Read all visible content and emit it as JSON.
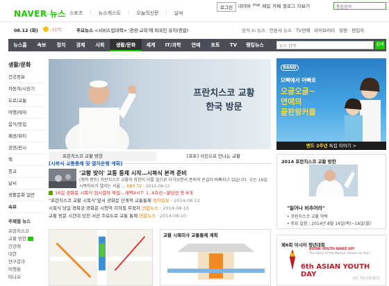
{
  "brand": {
    "logo": "NAVER",
    "section": "뉴스"
  },
  "top_nav": [
    "스포츠",
    "뉴스캐스트",
    "오늘의신문",
    "날씨"
  ],
  "util_links": {
    "login": "로그인",
    "items": [
      "네이버",
      "me",
      "메일",
      "카페",
      "블로그",
      "더보기"
    ]
  },
  "top_search": {
    "placeholder": "통합검색"
  },
  "datebar": {
    "date": "08.12 (화)",
    "temp": "31℃",
    "hot_label": "주요뉴스",
    "hot_text": "<서비스업대책> '관광·교육'에 외국인 유치(종합)",
    "right_links": [
      "상식 in 뉴스",
      "언론사 뉴스",
      "TV연예",
      "라이브러리",
      "칼럼",
      "편집자"
    ]
  },
  "navbar": {
    "items": [
      "뉴스홈",
      "속보",
      "정치",
      "경제",
      "사회",
      "생활/문화",
      "세계",
      "IT/과학",
      "연예",
      "포토",
      "TV",
      "랭킹뉴스"
    ],
    "active": "생활/문화",
    "search_placeholder": "뉴스 검색",
    "search_button": "검색"
  },
  "sidebar": {
    "section": "생활/문화",
    "items": [
      "건강정보",
      "자동차/시승기",
      "도로/교통",
      "여행/레저",
      "음식/맛집",
      "패션/뷰티",
      "공연/전시",
      "책",
      "종교",
      "날씨",
      "생활문화 일반"
    ],
    "section2": "속보",
    "section3": "주제별 뉴스",
    "topics": [
      "프란치스코",
      "교황 방한",
      "건강에",
      "대한",
      "연구결과",
      "여행을",
      "떠나요"
    ]
  },
  "hero": {
    "title_line1": "프란치스코 교황",
    "title_line2": "한국 방문"
  },
  "captions": {
    "left": "프란치스코 교황 방한",
    "right": "[포토] 사진으로 만나는 교황"
  },
  "special": "[시복식 교통통제 및 열차운행 계획]",
  "headline": {
    "title": "'교황 맞이' 교통 통제 시작…시복식 본격 준비",
    "summary": "(앵커 멘트) 프란치스코 교황의 방한이 이틀 앞으로 다가오면서 준비의 손길이 바빠지고 있습니다. 오는 16일 시복미사가 열리는 서울 ...",
    "source": "KBS TV",
    "date": "2014-08-12"
  },
  "news_list": [
    {
      "text": "16일 광화문 시복식 임시열차 투입…새벽4시7' 1, 4호선~분당선 등 8개",
      "source": "",
      "date": ""
    },
    {
      "text": "\"프란치스코 교황 시복식\"앞서 광화문 단계적 교통통제",
      "source": "동아일보",
      "date": "2014-08-12"
    },
    {
      "text": "시복식 당일 경복궁·광화문 시청역 지하철 무정차",
      "source": "연합뉴스",
      "date": "2014-08-10"
    },
    {
      "text": "교황 방문 시간대 당진·서산 주요도로 교통 통제",
      "source": "연합뉴스",
      "date": "2014-08-10"
    }
  ],
  "map2_title": "교황 시복미사 교통통제 계획",
  "band": {
    "logo": "BAND",
    "line1": "오빠에서 아빠로",
    "line2": "오글오글~",
    "line3": "연애의",
    "line4": "끝판왕커플",
    "caption_b": "밴드 2주년",
    "caption_rest": " 특집 이야기 >"
  },
  "pope_box": {
    "title": "2014 프란치스코 교황 방한",
    "quote": "\"일어나 비추어라\"",
    "meta1": "• 프란치스코 교황 약력",
    "meta2": "• 주요 일정 : 2014년 8월 14일(목)~18일(월)"
  },
  "ayd": {
    "title": "제6회 아시아 청년대회",
    "wake": "ASIAN YOUTH WAKE UP!",
    "sub": "The Glory of the Martyrs Shines on You!",
    "big": "6th ASIAN YOUTH DAY"
  },
  "watermark": "MT 머니투데이"
}
